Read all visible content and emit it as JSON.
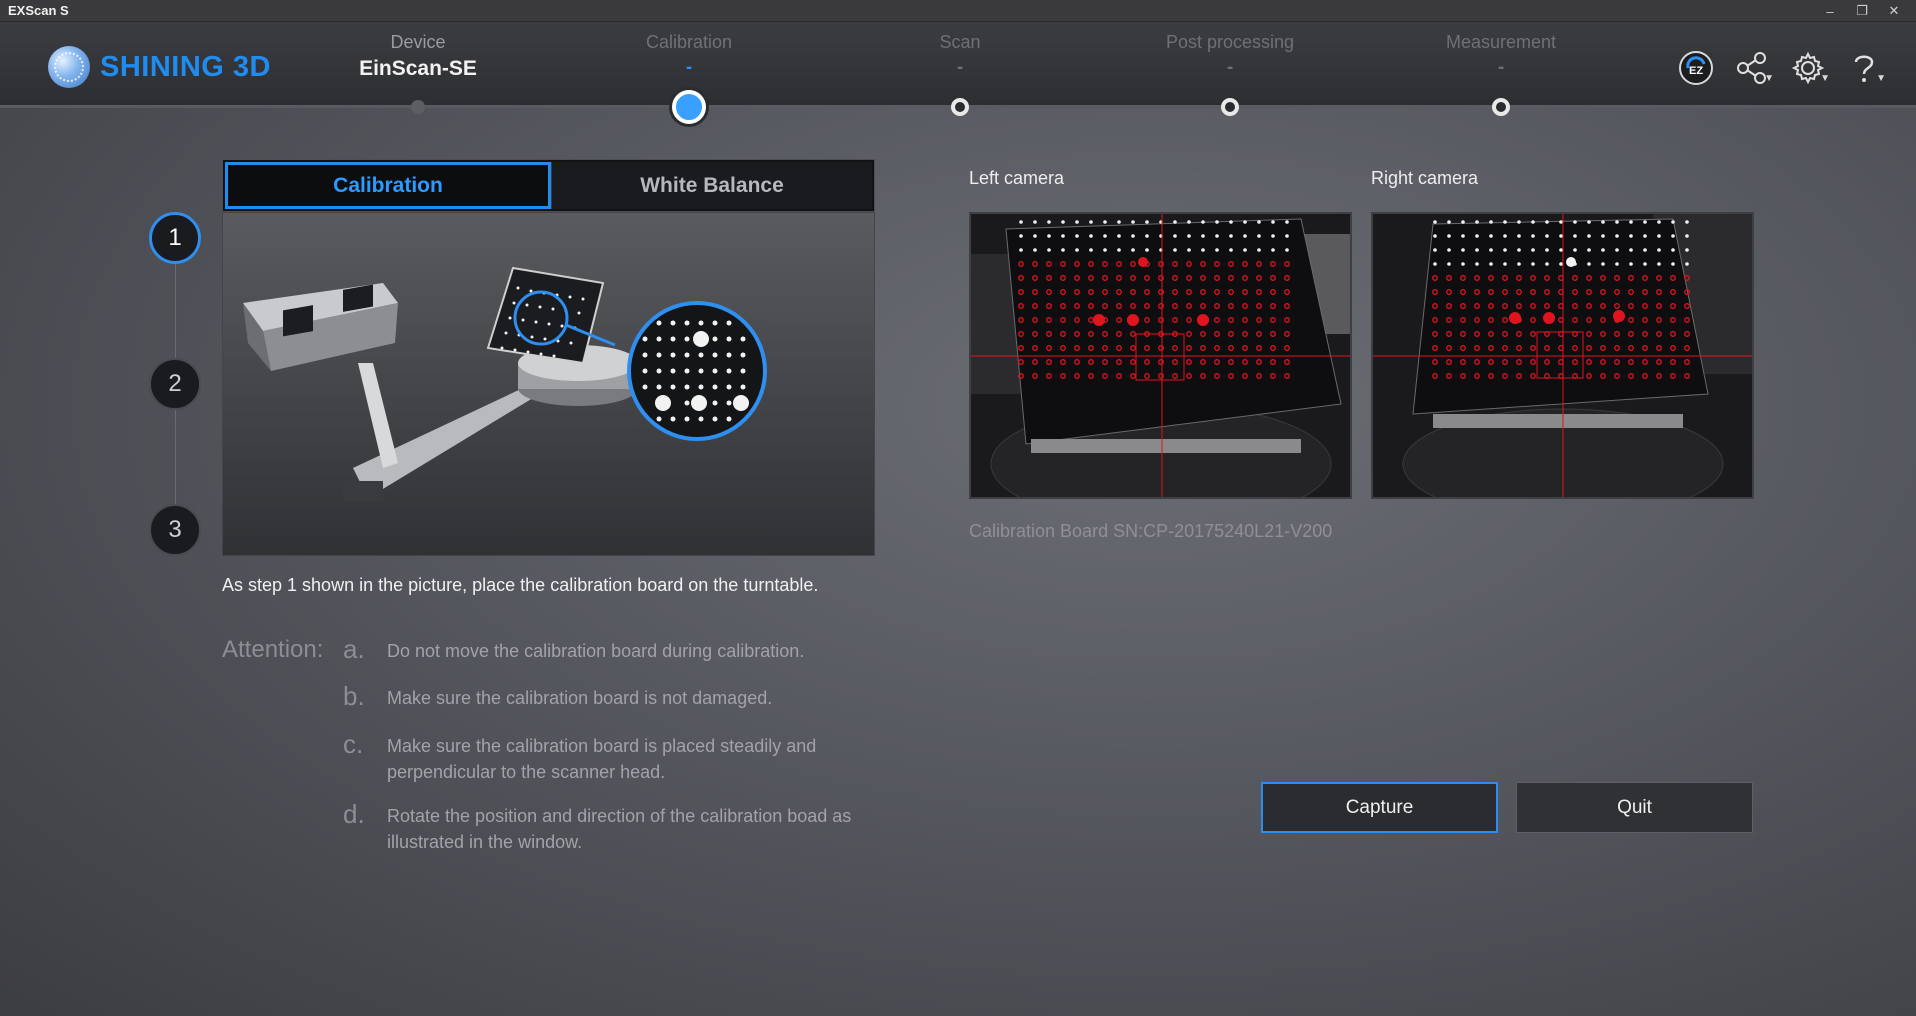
{
  "window": {
    "title": "EXScan S",
    "controls": [
      "–",
      "❐",
      "✕"
    ]
  },
  "brand": {
    "name": "SHINING 3D"
  },
  "steps": [
    {
      "label": "Device",
      "value": "EinScan-SE",
      "state": "done"
    },
    {
      "label": "Calibration",
      "value": "-",
      "state": "active"
    },
    {
      "label": "Scan",
      "value": "-",
      "state": "pending"
    },
    {
      "label": "Post processing",
      "value": "-",
      "state": "pending"
    },
    {
      "label": "Measurement",
      "value": "-",
      "state": "pending"
    }
  ],
  "header_icons": [
    "ez-mode-icon",
    "share-icon",
    "settings-icon",
    "help-icon"
  ],
  "colors": {
    "accent": "#1f8cf0",
    "marker_red": "#e0141e"
  },
  "step_numbers": [
    "1",
    "2",
    "3"
  ],
  "tabs": {
    "calibration": "Calibration",
    "white_balance": "White Balance"
  },
  "instruction": "As step 1 shown in the picture, place the calibration board on the turntable.",
  "attention": {
    "title": "Attention:",
    "items": [
      {
        "letter": "a.",
        "text": "Do not move the calibration board during calibration."
      },
      {
        "letter": "b.",
        "text": "Make sure the calibration board is not damaged."
      },
      {
        "letter": "c.",
        "text": "Make sure the calibration board is placed steadily and perpendicular to the scanner head."
      },
      {
        "letter": "d.",
        "text": "Rotate the position and direction of the calibration boad as illustrated in the window."
      }
    ]
  },
  "cameras": {
    "left_label": "Left camera",
    "right_label": "Right camera"
  },
  "serial": "Calibration Board SN:CP-20175240L21-V200",
  "buttons": {
    "capture": "Capture",
    "quit": "Quit"
  }
}
